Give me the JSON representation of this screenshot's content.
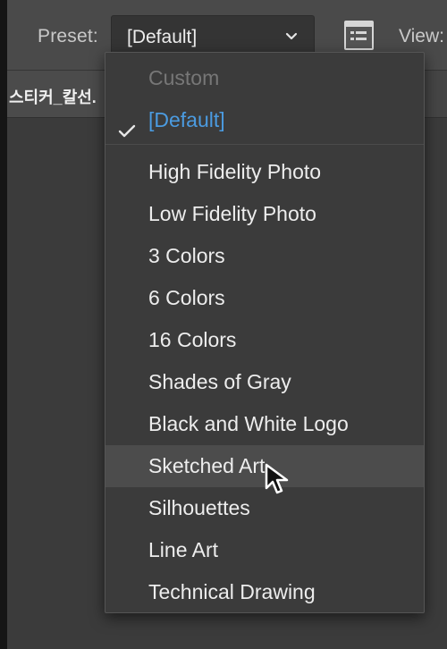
{
  "toolbar": {
    "preset_label": "Preset:",
    "preset_value": "[Default]",
    "view_label": "View:",
    "icons": {
      "dropdown": "chevron-down-icon",
      "panel_toggle": "panel-toggle-icon"
    }
  },
  "document_tab": {
    "label": "스티커_칼선."
  },
  "dropdown": {
    "items": [
      {
        "label": "Custom",
        "state": "disabled"
      },
      {
        "label": "[Default]",
        "state": "selected"
      },
      {
        "label": "High Fidelity Photo",
        "state": "normal"
      },
      {
        "label": "Low Fidelity Photo",
        "state": "normal"
      },
      {
        "label": "3 Colors",
        "state": "normal"
      },
      {
        "label": "6 Colors",
        "state": "normal"
      },
      {
        "label": "16 Colors",
        "state": "normal"
      },
      {
        "label": "Shades of Gray",
        "state": "normal"
      },
      {
        "label": "Black and White Logo",
        "state": "normal"
      },
      {
        "label": "Sketched Art",
        "state": "hovered"
      },
      {
        "label": "Silhouettes",
        "state": "normal"
      },
      {
        "label": "Line Art",
        "state": "normal"
      },
      {
        "label": "Technical Drawing",
        "state": "normal"
      }
    ]
  },
  "colors": {
    "selected_text": "#4b9be0",
    "disabled_text": "#777777",
    "hover_background": "#4c4c4c",
    "menu_background": "#3b3b3b"
  },
  "cursor": {
    "icon": "arrow-cursor-icon"
  }
}
